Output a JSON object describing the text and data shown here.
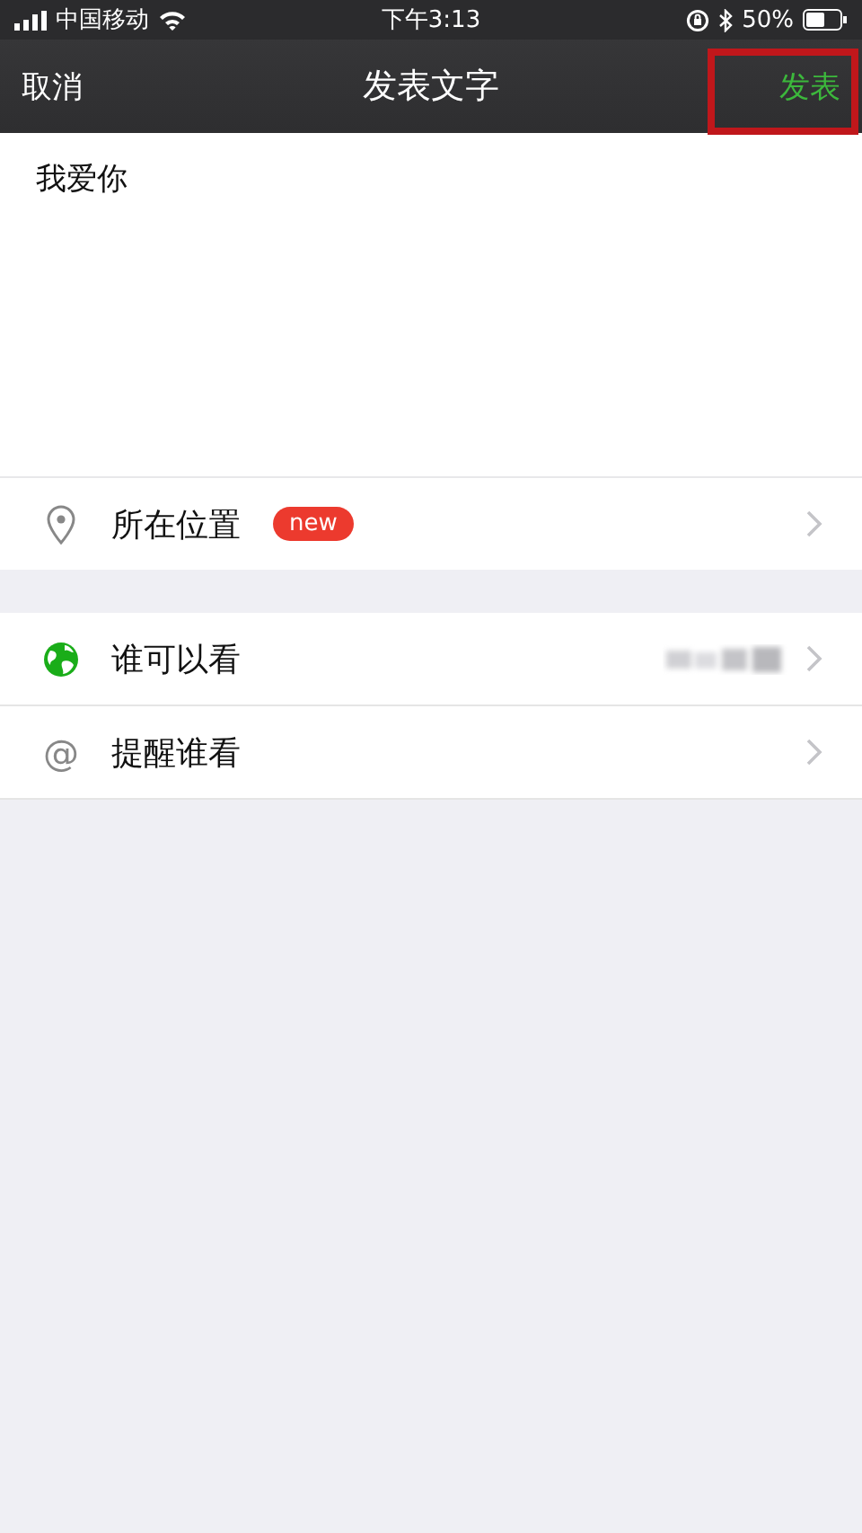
{
  "status_bar": {
    "carrier": "中国移动",
    "time": "下午3:13",
    "battery": "50%"
  },
  "nav": {
    "cancel": "取消",
    "title": "发表文字",
    "post": "发表",
    "post_highlighted": true
  },
  "composer": {
    "value": "我爱你"
  },
  "location": {
    "label": "所在位置",
    "badge": "new"
  },
  "options": [
    {
      "kind": "audience",
      "label": "谁可以看",
      "value_blurred": true
    },
    {
      "kind": "mention",
      "label": "提醒谁看",
      "icon_glyph": "@",
      "value_blurred": false
    }
  ]
}
